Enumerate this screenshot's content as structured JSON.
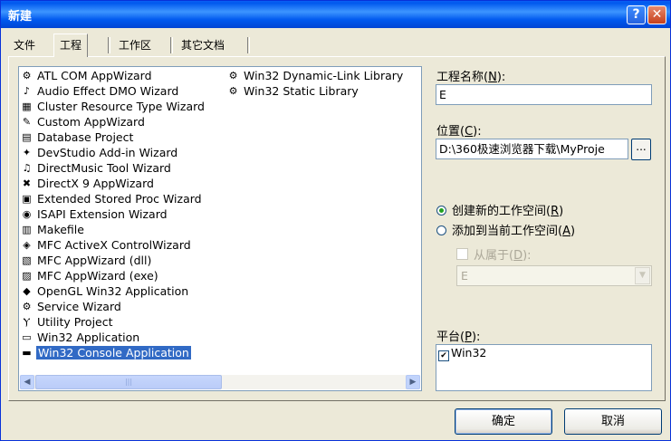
{
  "window": {
    "title": "新建"
  },
  "tabs": [
    "文件",
    "工程",
    "工作区",
    "其它文档"
  ],
  "project_types_col1": [
    {
      "label": "ATL COM AppWizard",
      "icon": "atl-icon"
    },
    {
      "label": "Audio Effect DMO Wizard",
      "icon": "audio-icon"
    },
    {
      "label": "Cluster Resource Type Wizard",
      "icon": "cluster-icon"
    },
    {
      "label": "Custom AppWizard",
      "icon": "custom-icon"
    },
    {
      "label": "Database Project",
      "icon": "database-icon"
    },
    {
      "label": "DevStudio Add-in Wizard",
      "icon": "addin-icon"
    },
    {
      "label": "DirectMusic Tool Wizard",
      "icon": "music-icon"
    },
    {
      "label": "DirectX 9 AppWizard",
      "icon": "directx-icon"
    },
    {
      "label": "Extended Stored Proc Wizard",
      "icon": "storedproc-icon"
    },
    {
      "label": "ISAPI Extension Wizard",
      "icon": "isapi-icon"
    },
    {
      "label": "Makefile",
      "icon": "makefile-icon"
    },
    {
      "label": "MFC ActiveX ControlWizard",
      "icon": "activex-icon"
    },
    {
      "label": "MFC AppWizard (dll)",
      "icon": "mfc-dll-icon"
    },
    {
      "label": "MFC AppWizard (exe)",
      "icon": "mfc-exe-icon"
    },
    {
      "label": "OpenGL Win32 Application",
      "icon": "opengl-icon"
    },
    {
      "label": "Service Wizard",
      "icon": "service-icon"
    },
    {
      "label": "Utility Project",
      "icon": "utility-icon"
    },
    {
      "label": "Win32 Application",
      "icon": "win32-app-icon"
    },
    {
      "label": "Win32 Console Application",
      "icon": "console-icon"
    }
  ],
  "project_types_col2": [
    {
      "label": "Win32 Dynamic-Link Library",
      "icon": "dll-icon"
    },
    {
      "label": "Win32 Static Library",
      "icon": "lib-icon"
    }
  ],
  "project_name": {
    "label": "工程名称",
    "accel": "N",
    "value": "E"
  },
  "location": {
    "label": "位置",
    "accel": "C",
    "value": "D:\\360极速浏览器下载\\MyProje",
    "browse": "..."
  },
  "workspace_options": {
    "create_new": {
      "label": "创建新的工作空间",
      "accel": "R"
    },
    "add_current": {
      "label": "添加到当前工作空间",
      "accel": "A"
    },
    "dependency": {
      "label": "从属于",
      "accel": "D"
    },
    "dependency_value": "E"
  },
  "platform": {
    "label": "平台",
    "accel": "P",
    "items": [
      "Win32"
    ]
  },
  "buttons": {
    "ok": "确定",
    "cancel": "取消"
  },
  "colors": {
    "title_bar": "#0058EE",
    "selection": "#316AC5",
    "dialog_bg": "#ECE9D8"
  }
}
